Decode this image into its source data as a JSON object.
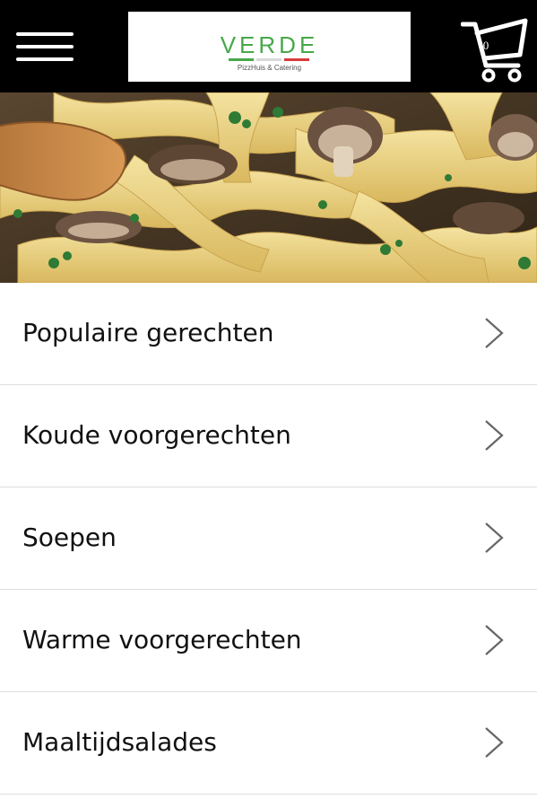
{
  "header": {
    "menu_icon": "hamburger-menu-icon",
    "cart_icon": "shopping-cart-icon",
    "cart_count": "0",
    "logo": {
      "wordmark": "VERDE",
      "tagline": "PizzHuis & Catering",
      "colors": [
        "#47a84a",
        "#d9d9d9",
        "#d93a3a"
      ]
    }
  },
  "hero": {
    "image": "pasta-with-mushrooms-photo"
  },
  "categories": [
    {
      "label": "Populaire gerechten",
      "icon": "chevron-right-icon"
    },
    {
      "label": "Koude voorgerechten",
      "icon": "chevron-right-icon"
    },
    {
      "label": "Soepen",
      "icon": "chevron-right-icon"
    },
    {
      "label": "Warme voorgerechten",
      "icon": "chevron-right-icon"
    },
    {
      "label": "Maaltijdsalades",
      "icon": "chevron-right-icon"
    }
  ],
  "theme": {
    "header_bg": "#000000",
    "divider": "#dedede",
    "text": "#111111"
  }
}
